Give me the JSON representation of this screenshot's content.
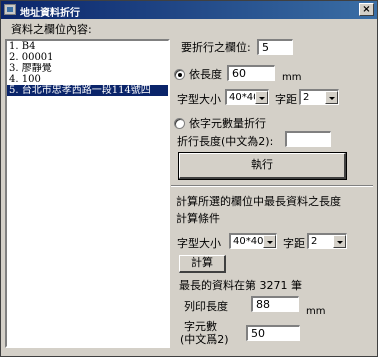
{
  "window": {
    "title": "地址資料折行",
    "close_label": "×"
  },
  "left_panel": {
    "label": "資料之欄位內容:",
    "items": [
      "1. B4",
      "2. 00001",
      "3. 廖靜覺",
      "4. 100",
      "5. 台北市忠孝西路一段114號四"
    ],
    "selected_index": 4
  },
  "wrap_settings": {
    "field_label": "要折行之欄位:",
    "field_value": "5",
    "by_length_label": "依長度",
    "length_value": "60",
    "length_unit": "mm",
    "font_size_label": "字型大小",
    "font_size_value": "40*40",
    "spacing_label": "字距",
    "spacing_value": "2",
    "by_chars_label": "依字元數量折行",
    "wrap_length_label": "折行長度(中文為2):",
    "wrap_length_value": "",
    "execute_label": "執行",
    "by_length_checked": true
  },
  "calc_section": {
    "title": "計算所選的欄位中最長資料之長度",
    "conditions_label": "計算條件",
    "font_size_label": "字型大小",
    "font_size_value": "40*40",
    "spacing_label": "字距",
    "spacing_value": "2",
    "calc_button_label": "計算",
    "result_text": "最長的資料在第 3271 筆",
    "print_length_label": "列印長度",
    "print_length_value": "88",
    "print_length_unit": "mm",
    "char_count_label_1": "字元數",
    "char_count_label_2": "(中文爲2)",
    "char_count_value": "50"
  }
}
